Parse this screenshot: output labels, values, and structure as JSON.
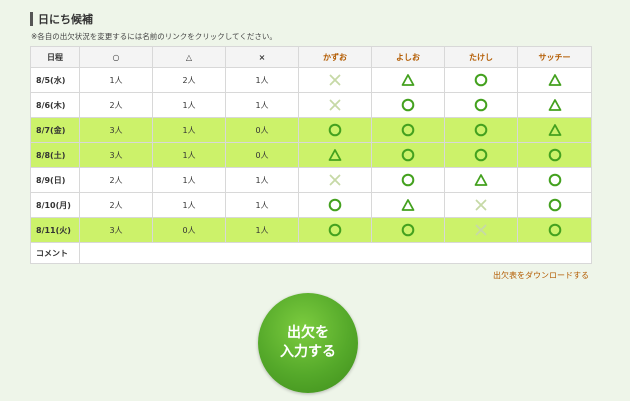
{
  "header": {
    "title": "日にち候補"
  },
  "note": "※各自の出欠状況を変更するには名前のリンクをクリックしてください。",
  "table": {
    "col_date": "日程",
    "col_o": "○",
    "col_tri": "△",
    "col_x": "×",
    "members": [
      "かずお",
      "よしお",
      "たけし",
      "サッチー"
    ],
    "rows": [
      {
        "date": "8/5(水)",
        "o": "1人",
        "tri": "2人",
        "x": "1人",
        "marks": [
          "x",
          "tri",
          "o",
          "tri"
        ],
        "hl": false
      },
      {
        "date": "8/6(木)",
        "o": "2人",
        "tri": "1人",
        "x": "1人",
        "marks": [
          "x",
          "o",
          "o",
          "tri"
        ],
        "hl": false
      },
      {
        "date": "8/7(金)",
        "o": "3人",
        "tri": "1人",
        "x": "0人",
        "marks": [
          "o",
          "o",
          "o",
          "tri"
        ],
        "hl": true
      },
      {
        "date": "8/8(土)",
        "o": "3人",
        "tri": "1人",
        "x": "0人",
        "marks": [
          "tri",
          "o",
          "o",
          "o"
        ],
        "hl": true
      },
      {
        "date": "8/9(日)",
        "o": "2人",
        "tri": "1人",
        "x": "1人",
        "marks": [
          "x",
          "o",
          "tri",
          "o"
        ],
        "hl": false
      },
      {
        "date": "8/10(月)",
        "o": "2人",
        "tri": "1人",
        "x": "1人",
        "marks": [
          "o",
          "tri",
          "x",
          "o"
        ],
        "hl": false
      },
      {
        "date": "8/11(火)",
        "o": "3人",
        "tri": "0人",
        "x": "1人",
        "marks": [
          "o",
          "o",
          "x",
          "o"
        ],
        "hl": true
      }
    ],
    "comment_label": "コメント"
  },
  "download_link": "出欠表をダウンロードする",
  "enter_button": {
    "line1": "出欠を",
    "line2": "入力する"
  },
  "colors": {
    "mark": "#44a11f",
    "mark_x": "#c6d9a6",
    "highlight": "#ccf26a",
    "member_name": "#b35b00",
    "button": "#55a92a"
  }
}
